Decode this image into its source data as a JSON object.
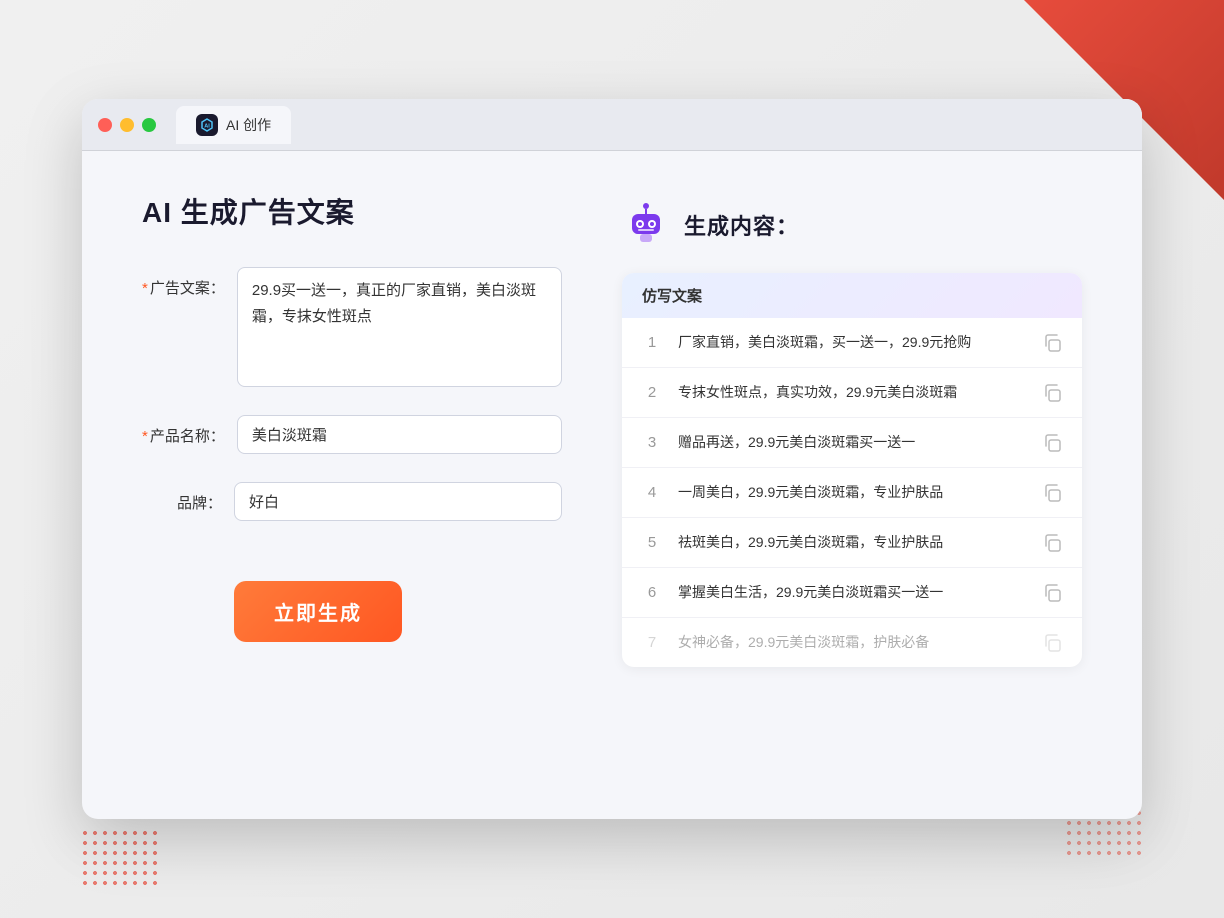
{
  "browser": {
    "tab_label": "AI 创作",
    "traffic_lights": [
      "red",
      "yellow",
      "green"
    ]
  },
  "left_panel": {
    "title": "AI 生成广告文案",
    "fields": [
      {
        "label": "广告文案：",
        "required": true,
        "type": "textarea",
        "value": "29.9买一送一，真正的厂家直销，美白淡斑霜，专抹女性斑点",
        "name": "ad-copy-field"
      },
      {
        "label": "产品名称：",
        "required": true,
        "type": "input",
        "value": "美白淡斑霜",
        "name": "product-name-field"
      },
      {
        "label": "品牌：",
        "required": false,
        "type": "input",
        "value": "好白",
        "name": "brand-field"
      }
    ],
    "generate_button": "立即生成"
  },
  "right_panel": {
    "title": "生成内容：",
    "table_header": "仿写文案",
    "results": [
      {
        "num": "1",
        "text": "厂家直销，美白淡斑霜，买一送一，29.9元抢购",
        "dimmed": false
      },
      {
        "num": "2",
        "text": "专抹女性斑点，真实功效，29.9元美白淡斑霜",
        "dimmed": false
      },
      {
        "num": "3",
        "text": "赠品再送，29.9元美白淡斑霜买一送一",
        "dimmed": false
      },
      {
        "num": "4",
        "text": "一周美白，29.9元美白淡斑霜，专业护肤品",
        "dimmed": false
      },
      {
        "num": "5",
        "text": "祛斑美白，29.9元美白淡斑霜，专业护肤品",
        "dimmed": false
      },
      {
        "num": "6",
        "text": "掌握美白生活，29.9元美白淡斑霜买一送一",
        "dimmed": false
      },
      {
        "num": "7",
        "text": "女神必备，29.9元美白淡斑霜，护肤必备",
        "dimmed": true
      }
    ]
  }
}
